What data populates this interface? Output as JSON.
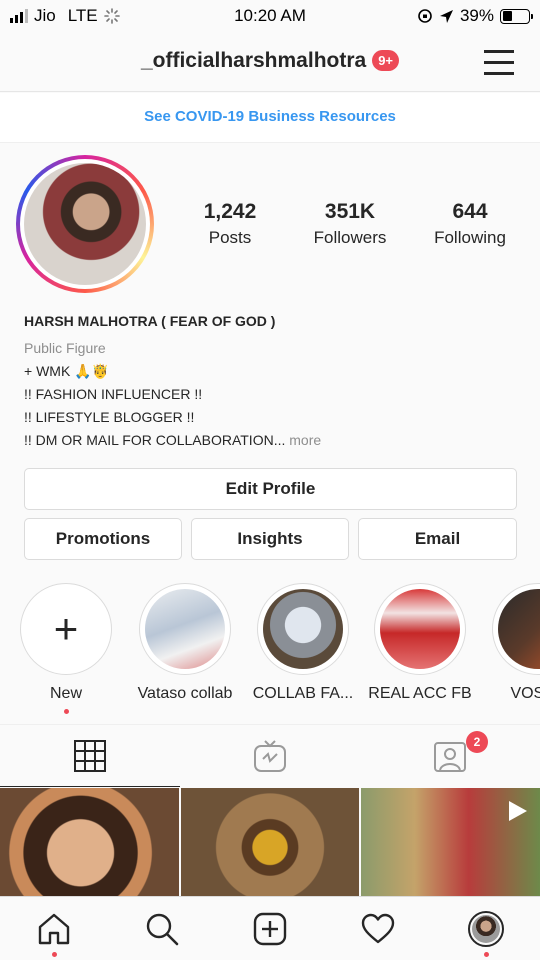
{
  "status_bar": {
    "carrier": "Jio",
    "network": "LTE",
    "time": "10:20 AM",
    "battery_percent": "39%",
    "battery_level": 0.39
  },
  "header": {
    "username": "_officialharshmalhotra",
    "notification_badge": "9+"
  },
  "banner": {
    "text": "See COVID-19 Business Resources"
  },
  "profile": {
    "stats": [
      {
        "value": "1,242",
        "label": "Posts"
      },
      {
        "value": "351K",
        "label": "Followers"
      },
      {
        "value": "644",
        "label": "Following"
      }
    ],
    "name": "HARSH MALHOTRA ( FEAR OF GOD )",
    "category": "Public Figure",
    "bio_lines": [
      "+ WMK 🙏🤴",
      "!! FASHION INFLUENCER !!",
      "!! LIFESTYLE BLOGGER !!",
      "!! DM OR MAIL FOR COLLABORATION..."
    ],
    "more": "more"
  },
  "buttons": {
    "edit_profile": "Edit Profile",
    "promotions": "Promotions",
    "insights": "Insights",
    "email": "Email"
  },
  "highlights": [
    {
      "label": "New"
    },
    {
      "label": "Vataso collab"
    },
    {
      "label": "COLLAB FA..."
    },
    {
      "label": "REAL ACC FB"
    },
    {
      "label": "VOSTR"
    }
  ],
  "tabs": {
    "tagged_badge": "2"
  },
  "colors": {
    "accent_blue": "#3897f0",
    "badge_red": "#ed4956",
    "text": "#262626",
    "muted": "#8e8e8e"
  },
  "icons": [
    "home-icon",
    "search-icon",
    "add-post-icon",
    "heart-icon",
    "profile-avatar",
    "grid-icon",
    "igtv-icon",
    "tagged-icon",
    "menu-icon"
  ]
}
